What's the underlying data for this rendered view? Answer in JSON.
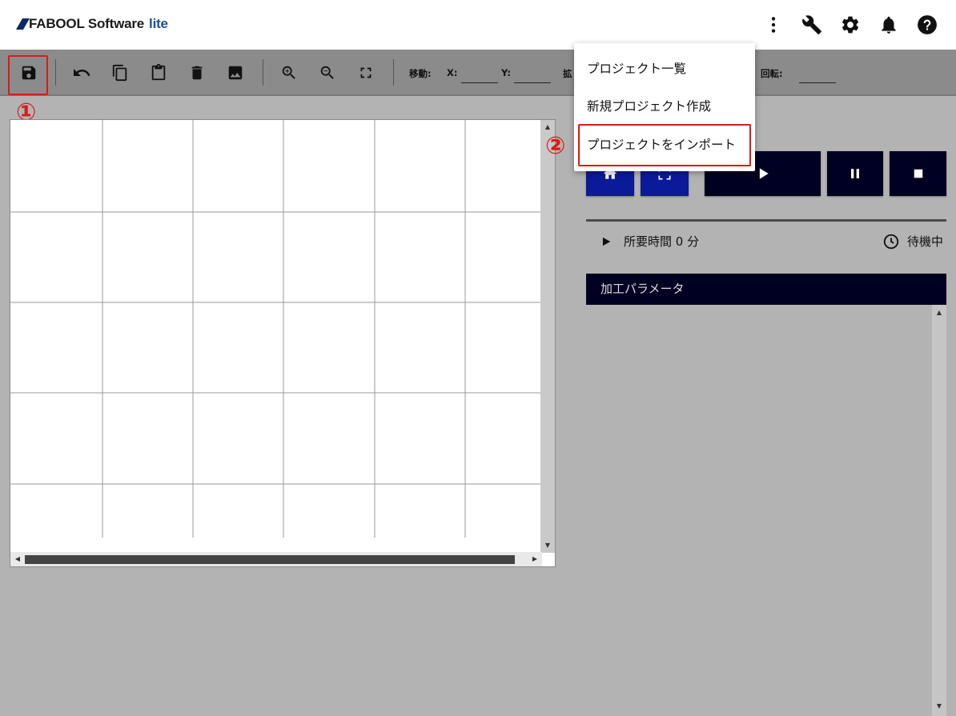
{
  "header": {
    "brand": "FABOOL Software",
    "brand_suffix": "lite",
    "icons": [
      "more-vert-icon",
      "wrench-icon",
      "gear-icon",
      "bell-icon",
      "help-icon"
    ]
  },
  "toolbar": {
    "buttons": [
      "save-icon",
      "undo-icon",
      "copy-icon",
      "paste-icon",
      "delete-icon",
      "image-icon",
      "zoom-in-icon",
      "zoom-out-icon",
      "fit-screen-icon"
    ],
    "move_label": "移動:",
    "x_label": "X:",
    "y_label": "Y:",
    "scale_label": "拡",
    "rotate_label": "回転:",
    "x_value": "",
    "y_value": "",
    "rotate_value": ""
  },
  "annotations": {
    "step1": "①",
    "step2": "②"
  },
  "menu": {
    "items": [
      "プロジェクト一覧",
      "新規プロジェクト作成",
      "プロジェクトをインポート"
    ]
  },
  "controls": {
    "home_icon": "home-icon",
    "frame_icon": "frame-icon",
    "play_icon": "play-icon",
    "pause_icon": "pause-icon",
    "stop_icon": "stop-icon"
  },
  "status": {
    "time_label": "所要時間 0 分",
    "state_label": "待機中"
  },
  "params": {
    "title": "加工パラメータ"
  },
  "colors": {
    "accent_dark": "#000022",
    "button_blue": "#0a1a99",
    "highlight_red": "#d81b1b"
  }
}
